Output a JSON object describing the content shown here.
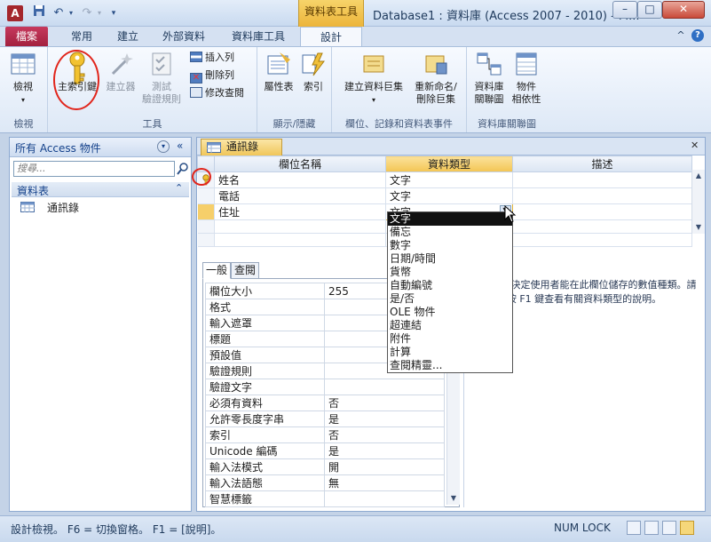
{
  "window": {
    "app_icon": "A",
    "title": "Database1 : 資料庫 (Access 2007 - 2010) - M...",
    "context_tab_header": "資料表工具",
    "minimize": "–",
    "maximize": "□",
    "close": "✕"
  },
  "tabs": {
    "file": "檔案",
    "items": [
      "常用",
      "建立",
      "外部資料",
      "資料庫工具",
      "設計"
    ]
  },
  "ribbon": {
    "groups": {
      "views": "檢視",
      "tools": "工具",
      "show_hide": "顯示/隱藏",
      "field_record_events": "欄位、記錄和資料表事件",
      "relationships": "資料庫關聯圖"
    },
    "view_btn": "檢視",
    "primary_key_btn": "主索引鍵",
    "builder_btn": "建立器",
    "test_rules_btn": [
      "測試",
      "驗證規則"
    ],
    "insert_rows": "插入列",
    "delete_rows": "刪除列",
    "modify_lookups": "修改查閱",
    "property_sheet_btn": "屬性表",
    "indexes_btn": "索引",
    "create_macros_btn": [
      "建立資料巨集"
    ],
    "rename_delete_macro_btn": [
      "重新命名/",
      "刪除巨集"
    ],
    "relationships_btn": [
      "資料庫",
      "關聯圖"
    ],
    "dependencies_btn": [
      "物件",
      "相依性"
    ]
  },
  "nav": {
    "header": "所有 Access 物件",
    "search_placeholder": "搜尋...",
    "group": "資料表",
    "items": [
      "通訊錄"
    ]
  },
  "document": {
    "tab": "通訊錄",
    "columns": [
      "欄位名稱",
      "資料類型",
      "描述"
    ],
    "rows": [
      {
        "name": "姓名",
        "type": "文字"
      },
      {
        "name": "電話",
        "type": "文字"
      },
      {
        "name": "住址",
        "type": "文字"
      }
    ],
    "dropdown_options": [
      "文字",
      "備忘",
      "數字",
      "日期/時間",
      "貨幣",
      "自動編號",
      "是/否",
      "OLE 物件",
      "超連結",
      "附件",
      "計算",
      "查閱精靈..."
    ],
    "property_tabs": [
      "一般",
      "查閱"
    ],
    "properties": [
      [
        "欄位大小",
        "255"
      ],
      [
        "格式",
        ""
      ],
      [
        "輸入遮罩",
        ""
      ],
      [
        "標題",
        ""
      ],
      [
        "預設值",
        ""
      ],
      [
        "驗證規則",
        ""
      ],
      [
        "驗證文字",
        ""
      ],
      [
        "必須有資料",
        "否"
      ],
      [
        "允許零長度字串",
        "是"
      ],
      [
        "索引",
        "否"
      ],
      [
        "Unicode 編碼",
        "是"
      ],
      [
        "輸入法模式",
        "開"
      ],
      [
        "輸入法語態",
        "無"
      ],
      [
        "智慧標籤",
        ""
      ]
    ],
    "help_text": "資料類型決定使用者能在此欄位儲存的數值種類。請按 F1 鍵查看有關資料類型的說明。"
  },
  "status": {
    "text": "設計檢視。 F6 = 切換窗格。 F1 = [說明]。",
    "numlock": "NUM LOCK"
  }
}
